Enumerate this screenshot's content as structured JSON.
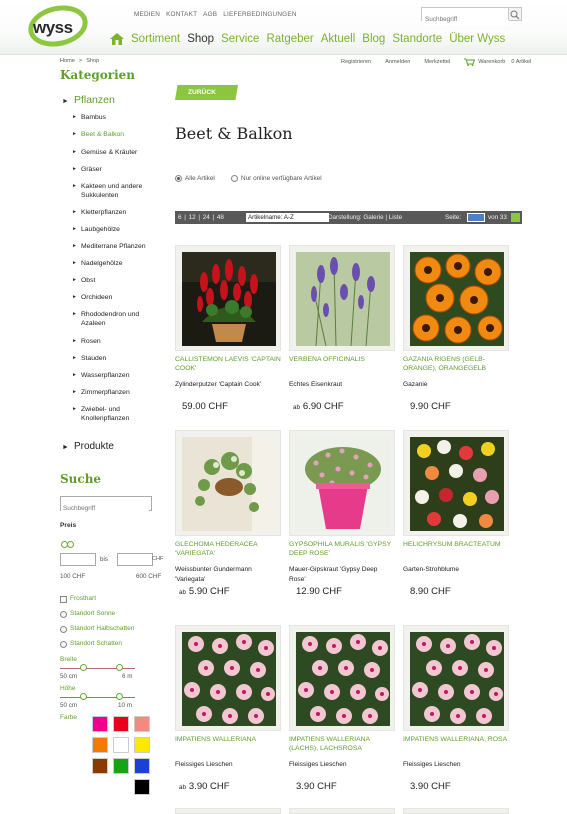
{
  "header": {
    "logo_text": "wyss",
    "topnav": [
      "MEDIEN",
      "KONTAKT",
      "AGB",
      "LIEFERBEDINGUNGEN"
    ],
    "search_placeholder": "Suchbegriff",
    "mainnav": [
      "Sortiment",
      "Shop",
      "Service",
      "Ratgeber",
      "Aktuell",
      "Blog",
      "Standorte",
      "Über Wyss"
    ],
    "mainnav_active": "Shop"
  },
  "subbar": {
    "breadcrumb": [
      "Home",
      ">",
      "Shop"
    ],
    "links": [
      "Registrieren",
      "Anmelden",
      "Merkzettel",
      "Warenkorb",
      "0 Artikel"
    ]
  },
  "sidebar": {
    "heading": "Kategorien",
    "main_category": "Pflanzen",
    "subcategories": [
      "Bambus",
      "Beet & Balkon",
      "Gemüse & Kräuter",
      "Gräser",
      "Kakteen und andere Sukkulenten",
      "Kletterpflanzen",
      "Laubgehölze",
      "Mediterrane Pflanzen",
      "Nadelgehölze",
      "Obst",
      "Orchideen",
      "Rhododendron und Azaleen",
      "Rosen",
      "Stauden",
      "Wasserpflanzen",
      "Zimmerpflanzen",
      "Zwiebel- und Knollenpflanzen"
    ],
    "active_subcategory": "Beet & Balkon",
    "products_category": "Produkte",
    "search_heading": "Suche",
    "search_placeholder": "Suchbegriff",
    "price_label": "Preis",
    "price_bis": "bis",
    "price_unit": "CHF",
    "price_min": "100 CHF",
    "price_max": "600 CHF",
    "frosthart": "Frosthart",
    "standorte": [
      "Standort Sonne",
      "Standort Halbschatten",
      "Standort Schatten"
    ],
    "breite_label": "Breite",
    "breite_min": "50 cm",
    "breite_max": "6 m",
    "hoehe_label": "Höhe",
    "hoehe_min": "50 cm",
    "hoehe_max": "10 m",
    "farbe_label": "Farbe",
    "colors": [
      "#f0008c",
      "#e8001c",
      "#f28a80",
      "#f27a00",
      "#ffffff",
      "#ffe800",
      "#8a3a00",
      "#17a317",
      "#1c3fd6",
      "#000000"
    ]
  },
  "content": {
    "back_label": "ZURÜCK",
    "title": "Beet & Balkon",
    "filter_all": "Alle Artikel",
    "filter_online": "Nur online verfügbare Artikel",
    "toolbar": {
      "counts": "6 | 12 | 24 | 48",
      "sort": "Artikelname: A-Z",
      "darstellung": "Darstellung: Galerie | Liste",
      "seite": "Seite:",
      "von": "von 33"
    },
    "products": [
      {
        "name": "CALLISTEMON LAEVIS 'CAPTAIN COOK'",
        "desc": "Zylinderputzer 'Captain Cook'",
        "ab": "",
        "price": "59.00 CHF"
      },
      {
        "name": "VERBENA OFFICINALIS",
        "desc": "Echtes Eisenkraut",
        "ab": "ab",
        "price": "6.90 CHF"
      },
      {
        "name": "GAZANIA RIGENS (GELB-ORANGE), ORANGEGELB",
        "desc": "Gazanie",
        "ab": "",
        "price": "9.90 CHF"
      },
      {
        "name": "GLECHOMA HEDERACEA 'VARIEGATA'",
        "desc": "Weissbunter Gundermann 'Variegata'",
        "ab": "ab",
        "price": "5.90 CHF"
      },
      {
        "name": "GYPSOPHILA MURALIS 'GYPSY DEEP ROSE'",
        "desc": "Mauer-Gipskraut 'Gypsy Deep Rose'",
        "ab": "",
        "price": "12.90 CHF"
      },
      {
        "name": "HELICHRYSUM BRACTEATUM",
        "desc": "Garten-Strohblume",
        "ab": "",
        "price": "8.90 CHF"
      },
      {
        "name": "IMPATIENS WALLERIANA",
        "desc": "Fleissiges Lieschen",
        "ab": "ab",
        "price": "3.90 CHF"
      },
      {
        "name": "IMPATIENS WALLERIANA (LACHS), LACHSROSA",
        "desc": "Fleissiges Lieschen",
        "ab": "",
        "price": "3.90 CHF"
      },
      {
        "name": "IMPATIENS WALLERIANA, ROSA",
        "desc": "Fleissiges Lieschen",
        "ab": "",
        "price": "3.90 CHF"
      }
    ]
  }
}
